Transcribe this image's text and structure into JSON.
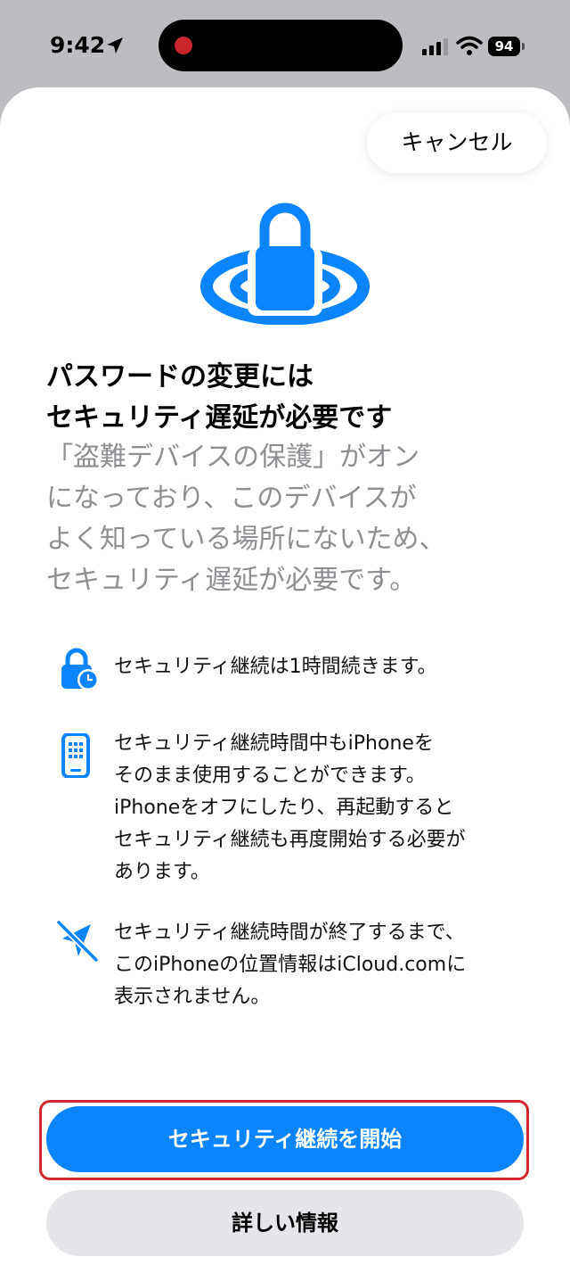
{
  "status_bar": {
    "time": "9:42",
    "battery": "94",
    "icons": [
      "location-arrow-icon",
      "cellular-signal-icon",
      "wifi-icon",
      "battery-icon"
    ]
  },
  "sheet": {
    "cancel_label": "キャンセル",
    "hero_icon": "lock-with-rings-icon",
    "title_lines": [
      "パスワードの変更には",
      "セキュリティ遅延が必要です"
    ],
    "subtitle_lines": [
      "「盗難デバイスの保護」がオン",
      "になっており、このデバイスが",
      "よく知っている場所にないため、",
      "セキュリティ遅延が必要です。"
    ],
    "features": [
      {
        "icon": "lock-clock-icon",
        "lines": [
          "セキュリティ継続は1時間続きます。"
        ]
      },
      {
        "icon": "iphone-icon",
        "lines": [
          "セキュリティ継続時間中もiPhoneを",
          "そのまま使用することができます。",
          "iPhoneをオフにしたり、再起動すると",
          "セキュリティ継続も再度開始する必要が",
          "あります。"
        ]
      },
      {
        "icon": "location-slash-icon",
        "lines": [
          "セキュリティ継続時間が終了するまで、",
          "このiPhoneの位置情報はiCloud.comに",
          "表示されません。"
        ]
      }
    ],
    "primary_button_label": "セキュリティ継続を開始",
    "secondary_button_label": "詳しい情報"
  },
  "colors": {
    "accent": "#0a84ff",
    "highlight": "#d3262b",
    "secondary_text": "#8e8e93",
    "secondary_button": "#e5e5ea"
  }
}
